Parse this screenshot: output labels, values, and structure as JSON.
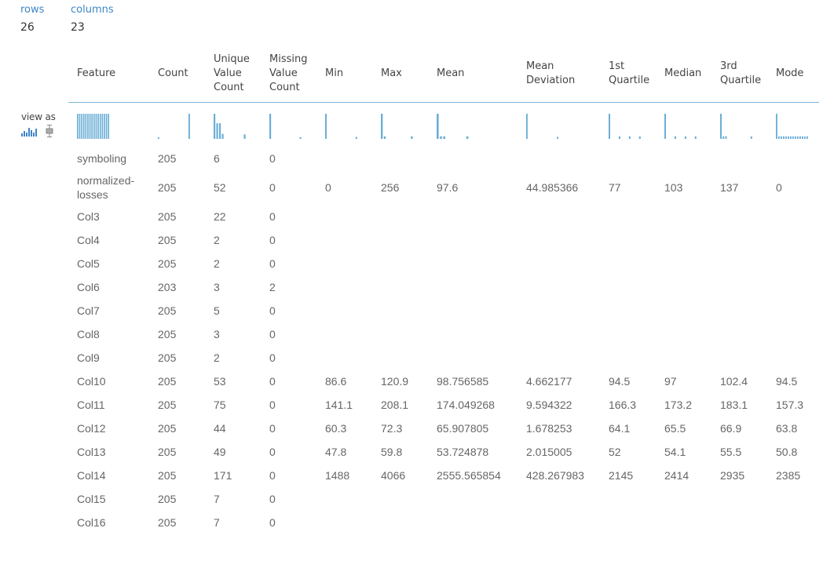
{
  "summary": {
    "rows_label": "rows",
    "rows_value": "26",
    "columns_label": "columns",
    "columns_value": "23"
  },
  "viewas": {
    "label": "view as",
    "histogram_icon": "histogram-icon",
    "boxplot_icon": "boxplot-icon"
  },
  "headers": [
    "Feature",
    "Count",
    "Unique Value Count",
    "Missing Value Count",
    "Min",
    "Max",
    "Mean",
    "Mean Deviation",
    "1st Quartile",
    "Median",
    "3rd Quartile",
    "Mode"
  ],
  "rows": [
    [
      "symboling",
      "205",
      "6",
      "0",
      "",
      "",
      "",
      "",
      "",
      "",
      "",
      ""
    ],
    [
      "normalized-losses",
      "205",
      "52",
      "0",
      "0",
      "256",
      "97.6",
      "44.985366",
      "77",
      "103",
      "137",
      "0"
    ],
    [
      "Col3",
      "205",
      "22",
      "0",
      "",
      "",
      "",
      "",
      "",
      "",
      "",
      ""
    ],
    [
      "Col4",
      "205",
      "2",
      "0",
      "",
      "",
      "",
      "",
      "",
      "",
      "",
      ""
    ],
    [
      "Col5",
      "205",
      "2",
      "0",
      "",
      "",
      "",
      "",
      "",
      "",
      "",
      ""
    ],
    [
      "Col6",
      "203",
      "3",
      "2",
      "",
      "",
      "",
      "",
      "",
      "",
      "",
      ""
    ],
    [
      "Col7",
      "205",
      "5",
      "0",
      "",
      "",
      "",
      "",
      "",
      "",
      "",
      ""
    ],
    [
      "Col8",
      "205",
      "3",
      "0",
      "",
      "",
      "",
      "",
      "",
      "",
      "",
      ""
    ],
    [
      "Col9",
      "205",
      "2",
      "0",
      "",
      "",
      "",
      "",
      "",
      "",
      "",
      ""
    ],
    [
      "Col10",
      "205",
      "53",
      "0",
      "86.6",
      "120.9",
      "98.756585",
      "4.662177",
      "94.5",
      "97",
      "102.4",
      "94.5"
    ],
    [
      "Col11",
      "205",
      "75",
      "0",
      "141.1",
      "208.1",
      "174.049268",
      "9.594322",
      "166.3",
      "173.2",
      "183.1",
      "157.3"
    ],
    [
      "Col12",
      "205",
      "44",
      "0",
      "60.3",
      "72.3",
      "65.907805",
      "1.678253",
      "64.1",
      "65.5",
      "66.9",
      "63.8"
    ],
    [
      "Col13",
      "205",
      "49",
      "0",
      "47.8",
      "59.8",
      "53.724878",
      "2.015005",
      "52",
      "54.1",
      "55.5",
      "50.8"
    ],
    [
      "Col14",
      "205",
      "171",
      "0",
      "1488",
      "4066",
      "2555.565854",
      "428.267983",
      "2145",
      "2414",
      "2935",
      "2385"
    ],
    [
      "Col15",
      "205",
      "7",
      "0",
      "",
      "",
      "",
      "",
      "",
      "",
      "",
      ""
    ],
    [
      "Col16",
      "205",
      "7",
      "0",
      "",
      "",
      "",
      "",
      "",
      "",
      "",
      ""
    ]
  ],
  "histograms": [
    {
      "column": "Feature",
      "bars": [
        1,
        1,
        1,
        1,
        1,
        1,
        1,
        1,
        1,
        1,
        1,
        1,
        1,
        1,
        1,
        1
      ]
    },
    {
      "column": "Count",
      "bars": [
        0.06,
        0,
        0,
        0,
        0,
        0,
        0,
        0,
        0,
        0,
        0,
        0,
        0,
        1
      ]
    },
    {
      "column": "Unique Value Count",
      "bars": [
        1,
        0.62,
        0.62,
        0.2,
        0,
        0,
        0,
        0,
        0,
        0,
        0,
        0.18
      ]
    },
    {
      "column": "Missing Value Count",
      "bars": [
        1,
        0,
        0,
        0,
        0,
        0,
        0,
        0,
        0,
        0,
        0,
        0.06
      ]
    },
    {
      "column": "Min",
      "bars": [
        1,
        0,
        0,
        0,
        0,
        0,
        0,
        0,
        0,
        0,
        0,
        0,
        0.08
      ]
    },
    {
      "column": "Max",
      "bars": [
        1,
        0.1,
        0,
        0,
        0,
        0,
        0,
        0,
        0,
        0,
        0.1
      ]
    },
    {
      "column": "Mean",
      "bars": [
        1,
        0.1,
        0.1,
        0,
        0,
        0,
        0,
        0,
        0,
        0.1
      ]
    },
    {
      "column": "Mean Deviation",
      "bars": [
        1,
        0,
        0,
        0,
        0,
        0,
        0,
        0,
        0,
        0,
        0,
        0,
        0,
        0.08
      ]
    },
    {
      "column": "1st Quartile",
      "bars": [
        1,
        0,
        0,
        0,
        0.1,
        0,
        0,
        0,
        0.1,
        0,
        0,
        0,
        0.1
      ]
    },
    {
      "column": "Median",
      "bars": [
        1,
        0,
        0,
        0,
        0.1,
        0,
        0,
        0,
        0.1,
        0,
        0,
        0,
        0.1
      ]
    },
    {
      "column": "3rd Quartile",
      "bars": [
        1,
        0.1,
        0.1,
        0,
        0,
        0,
        0,
        0,
        0,
        0,
        0,
        0,
        0.1
      ]
    },
    {
      "column": "Mode",
      "bars": [
        1,
        0.1,
        0.1,
        0.1,
        0.1,
        0.1,
        0.1,
        0.1,
        0.1,
        0.1,
        0.1,
        0.1,
        0.1,
        0.1
      ]
    }
  ],
  "colors": {
    "accent": "#3e86c6",
    "bar": "#6aaed6",
    "divider": "#7fb3d8"
  }
}
